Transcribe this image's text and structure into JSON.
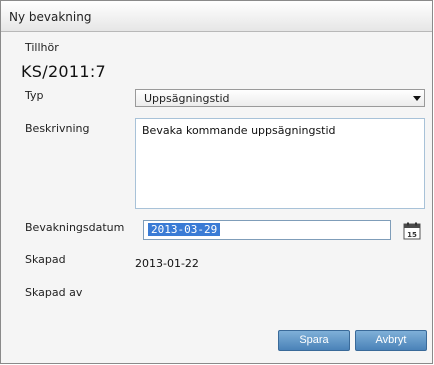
{
  "window": {
    "title": "Ny bevakning"
  },
  "form": {
    "belongs_label": "Tillhör",
    "case_number": "KS/2011:7",
    "type_label": "Typ",
    "type_value": "Uppsägningstid",
    "description_label": "Beskrivning",
    "description_value": "Bevaka kommande uppsägningstid",
    "date_label": "Bevakningsdatum",
    "date_value": "2013-03-29",
    "calendar_day": "15",
    "created_label": "Skapad",
    "created_value": "2013-01-22",
    "created_by_label": "Skapad av",
    "created_by_value": ""
  },
  "buttons": {
    "save": "Spara",
    "cancel": "Avbryt"
  },
  "colors": {
    "button": "#5a8fc4",
    "selection": "#3a7bd5"
  }
}
